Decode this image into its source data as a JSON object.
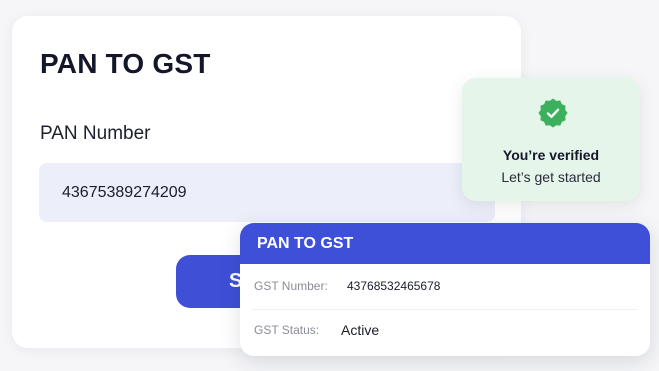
{
  "form": {
    "title": "PAN TO GST",
    "pan_label": "PAN Number",
    "pan_value": "43675389274209",
    "submit_label": "S"
  },
  "toast": {
    "icon": "check-badge-icon",
    "title": "You’re verified",
    "subtitle": "Let’s get started"
  },
  "result": {
    "title": "PAN TO GST",
    "rows": [
      {
        "label": "GST Number:",
        "value": "43768532465678"
      },
      {
        "label": "GST Status:",
        "value": "Active"
      }
    ]
  },
  "colors": {
    "accent": "#3f4fd6",
    "success": "#3cb05c",
    "toast_bg": "#e6f5ea",
    "input_bg": "#eceef9"
  }
}
